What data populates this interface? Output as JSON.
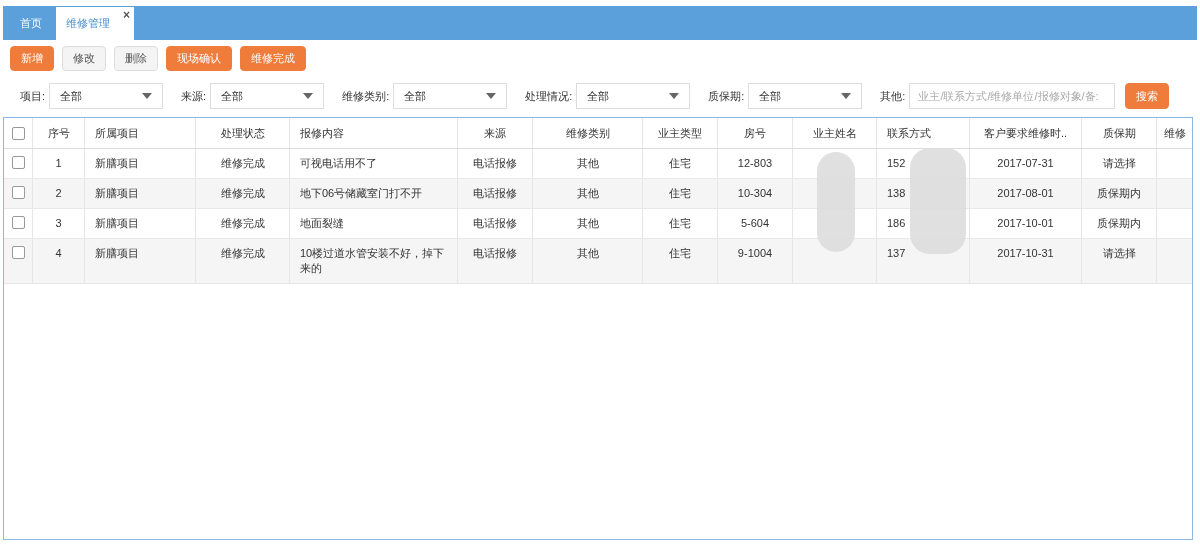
{
  "tabs": [
    {
      "label": "首页",
      "selected": false
    },
    {
      "label": "维修管理",
      "selected": true,
      "close": "×"
    }
  ],
  "toolbar": [
    {
      "label": "新增",
      "kind": "primary"
    },
    {
      "label": "修改",
      "kind": "default"
    },
    {
      "label": "删除",
      "kind": "default"
    },
    {
      "label": "现场确认",
      "kind": "primary"
    },
    {
      "label": "维修完成",
      "kind": "primary"
    }
  ],
  "filters": [
    {
      "label": "项目:",
      "value": "全部"
    },
    {
      "label": "来源:",
      "value": "全部"
    },
    {
      "label": "维修类别:",
      "value": "全部"
    },
    {
      "label": "处理情况:",
      "value": "全部"
    },
    {
      "label": "质保期:",
      "value": "全部"
    }
  ],
  "other": {
    "label": "其他:",
    "placeholder": "业主/联系方式/维修单位/报修对象/备:"
  },
  "search_button": "搜索",
  "table": {
    "all_checked": false,
    "columns": [
      "序号",
      "所属项目",
      "处理状态",
      "报修内容",
      "来源",
      "维修类别",
      "业主类型",
      "房号",
      "业主姓名",
      "联系方式",
      "客户要求维修时..",
      "质保期",
      "维修"
    ],
    "rows": [
      {
        "checked": false,
        "cells": [
          "1",
          "新膳项目",
          "维修完成",
          "可视电话用不了",
          "电话报修",
          "其他",
          "住宅",
          "12-803",
          "",
          "152",
          "2017-07-31",
          "请选择",
          ""
        ]
      },
      {
        "checked": false,
        "cells": [
          "2",
          "新膳项目",
          "维修完成",
          "地下06号储藏室门打不开",
          "电话报修",
          "其他",
          "住宅",
          "10-304",
          "",
          "138",
          "2017-08-01",
          "质保期内",
          ""
        ]
      },
      {
        "checked": false,
        "cells": [
          "3",
          "新膳项目",
          "维修完成",
          "地面裂缝",
          "电话报修",
          "其他",
          "住宅",
          "5-604",
          "",
          "186",
          "2017-10-01",
          "质保期内",
          ""
        ]
      },
      {
        "checked": false,
        "cells": [
          "4",
          "新膳项目",
          "维修完成",
          "10楼过道水管安装不好，掉下来的",
          "电话报修",
          "其他",
          "住宅",
          "9-1004",
          "",
          "137",
          "2017-10-31",
          "请选择",
          ""
        ]
      }
    ]
  }
}
